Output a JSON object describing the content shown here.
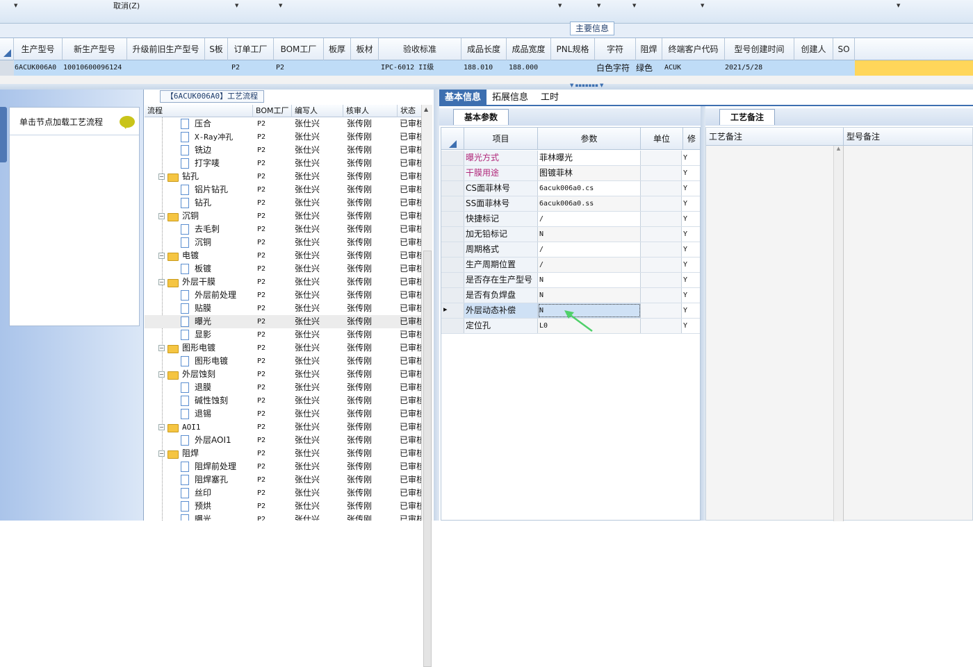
{
  "toolbar": {
    "cancel_label": "取消(Z)"
  },
  "main_info_tab": "主要信息",
  "product_grid": {
    "columns": [
      "生产型号",
      "新生产型号",
      "升级前旧生产型号",
      "S板",
      "订单工厂",
      "BOM工厂",
      "板厚",
      "板材",
      "验收标准",
      "成品长度",
      "成品宽度",
      "PNL规格",
      "字符",
      "阻焊",
      "终端客户代码",
      "型号创建时间",
      "创建人",
      "SO"
    ],
    "row": {
      "production_model": "6ACUK006A0",
      "new_model": "10010600096124",
      "order_factory": "P2",
      "bom_factory": "P2",
      "standard": "IPC-6012 II级",
      "length": "188.010",
      "width": "188.000",
      "character": "白色字符",
      "solder_mask": "绿色",
      "customer_code": "ACUK",
      "created": "2021/5/28"
    }
  },
  "left_panel": {
    "load_label": "单击节点加载工艺流程"
  },
  "process_panel": {
    "title": "【6ACUK006A0】工艺流程",
    "headers": {
      "flow": "流程",
      "bom": "BOM工厂",
      "author": "编写人",
      "reviewer": "核审人",
      "status": "状态"
    },
    "rows": [
      {
        "name": "压合",
        "type": "leaf",
        "bom": "P2",
        "author": "张仕兴",
        "reviewer": "张传刚",
        "status": "已审核"
      },
      {
        "name": "X-Ray冲孔",
        "type": "leaf",
        "bom": "P2",
        "author": "张仕兴",
        "reviewer": "张传刚",
        "status": "已审核"
      },
      {
        "name": "铣边",
        "type": "leaf",
        "bom": "P2",
        "author": "张仕兴",
        "reviewer": "张传刚",
        "status": "已审核"
      },
      {
        "name": "打字唛",
        "type": "leaf",
        "bom": "P2",
        "author": "张仕兴",
        "reviewer": "张传刚",
        "status": "已审核"
      },
      {
        "name": "钻孔",
        "type": "folder",
        "bom": "P2",
        "author": "张仕兴",
        "reviewer": "张传刚",
        "status": "已审核"
      },
      {
        "name": "铝片钻孔",
        "type": "leaf",
        "bom": "P2",
        "author": "张仕兴",
        "reviewer": "张传刚",
        "status": "已审核"
      },
      {
        "name": "钻孔",
        "type": "leaf",
        "bom": "P2",
        "author": "张仕兴",
        "reviewer": "张传刚",
        "status": "已审核"
      },
      {
        "name": "沉铜",
        "type": "folder",
        "bom": "P2",
        "author": "张仕兴",
        "reviewer": "张传刚",
        "status": "已审核"
      },
      {
        "name": "去毛刺",
        "type": "leaf",
        "bom": "P2",
        "author": "张仕兴",
        "reviewer": "张传刚",
        "status": "已审核"
      },
      {
        "name": "沉铜",
        "type": "leaf",
        "bom": "P2",
        "author": "张仕兴",
        "reviewer": "张传刚",
        "status": "已审核"
      },
      {
        "name": "电镀",
        "type": "folder",
        "bom": "P2",
        "author": "张仕兴",
        "reviewer": "张传刚",
        "status": "已审核"
      },
      {
        "name": "板镀",
        "type": "leaf",
        "bom": "P2",
        "author": "张仕兴",
        "reviewer": "张传刚",
        "status": "已审核"
      },
      {
        "name": "外层干膜",
        "type": "folder",
        "bom": "P2",
        "author": "张仕兴",
        "reviewer": "张传刚",
        "status": "已审核"
      },
      {
        "name": "外层前处理",
        "type": "leaf",
        "bom": "P2",
        "author": "张仕兴",
        "reviewer": "张传刚",
        "status": "已审核"
      },
      {
        "name": "贴膜",
        "type": "leaf",
        "bom": "P2",
        "author": "张仕兴",
        "reviewer": "张传刚",
        "status": "已审核"
      },
      {
        "name": "曝光",
        "type": "leaf",
        "selected": true,
        "bom": "P2",
        "author": "张仕兴",
        "reviewer": "张传刚",
        "status": "已审核"
      },
      {
        "name": "显影",
        "type": "leaf",
        "bom": "P2",
        "author": "张仕兴",
        "reviewer": "张传刚",
        "status": "已审核"
      },
      {
        "name": "图形电镀",
        "type": "folder",
        "bom": "P2",
        "author": "张仕兴",
        "reviewer": "张传刚",
        "status": "已审核"
      },
      {
        "name": "图形电镀",
        "type": "leaf",
        "bom": "P2",
        "author": "张仕兴",
        "reviewer": "张传刚",
        "status": "已审核"
      },
      {
        "name": "外层蚀刻",
        "type": "folder",
        "bom": "P2",
        "author": "张仕兴",
        "reviewer": "张传刚",
        "status": "已审核"
      },
      {
        "name": "退膜",
        "type": "leaf",
        "bom": "P2",
        "author": "张仕兴",
        "reviewer": "张传刚",
        "status": "已审核"
      },
      {
        "name": "碱性蚀刻",
        "type": "leaf",
        "bom": "P2",
        "author": "张仕兴",
        "reviewer": "张传刚",
        "status": "已审核"
      },
      {
        "name": "退锡",
        "type": "leaf",
        "bom": "P2",
        "author": "张仕兴",
        "reviewer": "张传刚",
        "status": "已审核"
      },
      {
        "name": "AOI1",
        "type": "folder",
        "bom": "P2",
        "author": "张仕兴",
        "reviewer": "张传刚",
        "status": "已审核"
      },
      {
        "name": "外层AOI1",
        "type": "leaf",
        "bom": "P2",
        "author": "张仕兴",
        "reviewer": "张传刚",
        "status": "已审核"
      },
      {
        "name": "阻焊",
        "type": "folder",
        "bom": "P2",
        "author": "张仕兴",
        "reviewer": "张传刚",
        "status": "已审核"
      },
      {
        "name": "阻焊前处理",
        "type": "leaf",
        "bom": "P2",
        "author": "张仕兴",
        "reviewer": "张传刚",
        "status": "已审核"
      },
      {
        "name": "阻焊塞孔",
        "type": "leaf",
        "bom": "P2",
        "author": "张仕兴",
        "reviewer": "张传刚",
        "status": "已审核"
      },
      {
        "name": "丝印",
        "type": "leaf",
        "bom": "P2",
        "author": "张仕兴",
        "reviewer": "张传刚",
        "status": "已审核"
      },
      {
        "name": "预烘",
        "type": "leaf",
        "bom": "P2",
        "author": "张仕兴",
        "reviewer": "张传刚",
        "status": "已审核"
      },
      {
        "name": "曝光",
        "type": "leaf",
        "bom": "P2",
        "author": "张仕兴",
        "reviewer": "张传刚",
        "status": "已审核"
      }
    ]
  },
  "detail_tabs": [
    "基本信息",
    "拓展信息",
    "工时"
  ],
  "basic_params": {
    "tab_label": "基本参数",
    "headers": {
      "item": "项目",
      "param": "参数",
      "unit": "单位",
      "extra": "修"
    },
    "rows": [
      {
        "item": "曝光方式",
        "value": "菲林曝光",
        "flag": "Y",
        "highlight": true
      },
      {
        "item": "干膜用途",
        "value": "图镀菲林",
        "flag": "Y",
        "highlight": true
      },
      {
        "item": "CS面菲林号",
        "value": "6acuk006a0.cs",
        "flag": "Y"
      },
      {
        "item": "SS面菲林号",
        "value": "6acuk006a0.ss",
        "flag": "Y"
      },
      {
        "item": "快捷标记",
        "value": "/",
        "flag": "Y"
      },
      {
        "item": "加无铅标记",
        "value": "N",
        "flag": "Y"
      },
      {
        "item": "周期格式",
        "value": "/",
        "flag": "Y"
      },
      {
        "item": "生产周期位置",
        "value": "/",
        "flag": "Y"
      },
      {
        "item": "是否存在生产型号",
        "value": "N",
        "flag": "Y"
      },
      {
        "item": "是否有负焊盘",
        "value": "N",
        "flag": "Y"
      },
      {
        "item": "外层动态补偿",
        "value": "N",
        "flag": "Y",
        "selected": true
      },
      {
        "item": "定位孔",
        "value": "L0",
        "flag": "Y"
      }
    ]
  },
  "notes": {
    "tab_label": "工艺备注",
    "headers": {
      "process_note": "工艺备注",
      "model_note": "型号备注"
    }
  },
  "colors": {
    "accent": "#3d6fb0",
    "highlight_text": "#b0287a",
    "row_select": "#bfdcf7",
    "arrow": "#4fd06a"
  }
}
